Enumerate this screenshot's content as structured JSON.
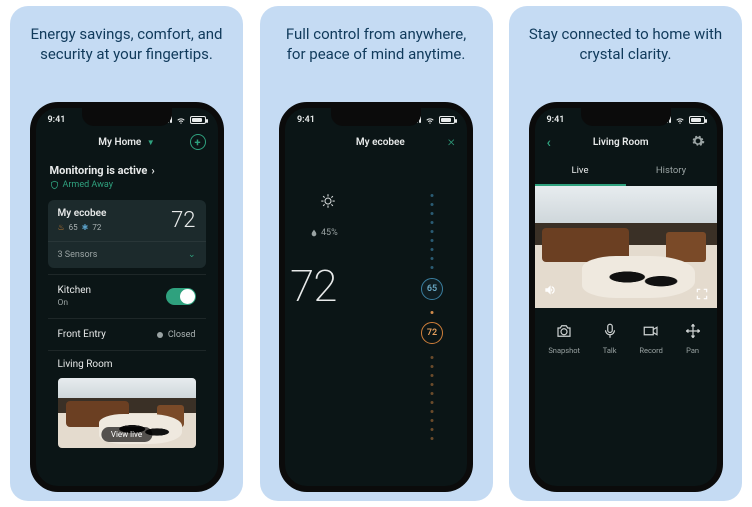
{
  "status_time": "9:41",
  "panels": [
    {
      "title": "Energy savings, comfort, and security at your fingertips.",
      "home_label": "My Home",
      "monitoring_title": "Monitoring is active",
      "monitoring_status": "Armed Away",
      "ecobee": {
        "name": "My ecobee",
        "heat": "65",
        "hum": "72",
        "temp": "72"
      },
      "sensors_label": "3 Sensors",
      "kitchen": {
        "name": "Kitchen",
        "state": "On"
      },
      "front_entry": {
        "name": "Front Entry",
        "state": "Closed"
      },
      "camera": {
        "name": "Living Room",
        "button": "View live"
      }
    },
    {
      "title": "Full control from anywhere, for peace of mind anytime.",
      "device_label": "My ecobee",
      "humidity": "45%",
      "temp": "72",
      "cool_set": "65",
      "heat_set": "72"
    },
    {
      "title": "Stay connected to home with crystal clarity.",
      "room_label": "Living Room",
      "tabs": {
        "live": "Live",
        "history": "History"
      },
      "controls": {
        "snapshot": "Snapshot",
        "talk": "Talk",
        "record": "Record",
        "pan": "Pan"
      }
    }
  ]
}
